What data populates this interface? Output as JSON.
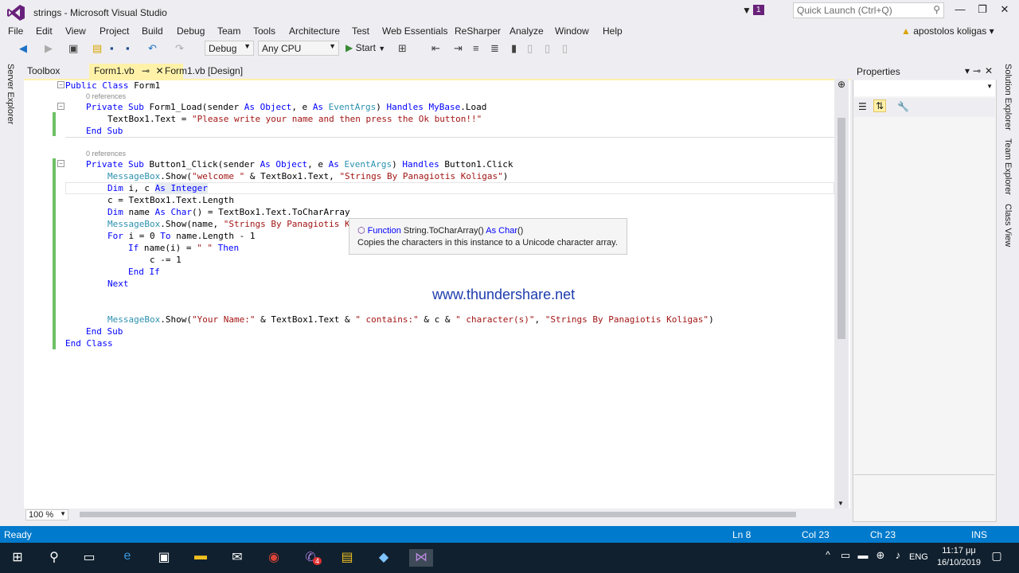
{
  "window": {
    "title": "strings - Microsoft Visual Studio",
    "notifications_count": "1",
    "quick_launch_placeholder": "Quick Launch (Ctrl+Q)",
    "user": "apostolos koligas"
  },
  "menu": [
    "File",
    "Edit",
    "View",
    "Project",
    "Build",
    "Debug",
    "Team",
    "Tools",
    "Architecture",
    "Test",
    "Web Essentials",
    "ReSharper",
    "Analyze",
    "Window",
    "Help"
  ],
  "toolbar": {
    "configuration": "Debug",
    "platform": "Any CPU",
    "start_label": "Start"
  },
  "left_rail": [
    "Server Explorer",
    "Toolbox"
  ],
  "tabs": [
    "Form1.vb",
    "Form1.vb [Design]"
  ],
  "code": {
    "l1": [
      "Public Class",
      " Form1"
    ],
    "refs": "0 references",
    "l2a": "Private Sub",
    "l2b": " Form1_Load(sender ",
    "l2c": "As Object",
    "l2d": ", e ",
    "l2e": "As",
    "l2f": " EventArgs",
    "l2g": ") ",
    "l2h": "Handles",
    "l2i": " MyBase",
    "l2j": ".Load",
    "l3a": "TextBox1.Text = ",
    "l3b": "\"Please write your name and then press the Ok button!!\"",
    "l4": "End Sub",
    "l5a": "Private Sub",
    "l5b": " Button1_Click(sender ",
    "l5c": "As Object",
    "l5d": ", e ",
    "l5e": "As",
    "l5f": " EventArgs",
    "l5g": ") ",
    "l5h": "Handles",
    "l5i": " Button1.Click",
    "l6a": "MessageBox",
    "l6b": ".Show(",
    "l6c": "\"welcome \"",
    "l6d": " & TextBox1.Text, ",
    "l6e": "\"Strings By Panagiotis Koligas\"",
    "l6f": ")",
    "l7a": "Dim",
    "l7b": " i, c ",
    "l7c": "As Integer",
    "l8": "c = TextBox1.Text.Length",
    "l9a": "Dim",
    "l9b": " name ",
    "l9c": "As Char",
    "l9d": "() = TextBox1.Text.ToCharArray",
    "l10a": "MessageBox",
    "l10b": ".Show(name, ",
    "l10c": "\"Strings By Panagiotis K",
    "l11a": "For",
    "l11b": " i = 0 ",
    "l11c": "To",
    "l11d": " name.Length - 1",
    "l12a": "If",
    "l12b": " name(i) = ",
    "l12c": "\" \"",
    "l12d": " Then",
    "l13": "c -= 1",
    "l14": "End If",
    "l15": "Next",
    "l16a": "MessageBox",
    "l16b": ".Show(",
    "l16c": "\"Your Name:\"",
    "l16d": " & TextBox1.Text & ",
    "l16e": "\" contains:\"",
    "l16f": " & c & ",
    "l16g": "\" character(s)\"",
    "l16h": ", ",
    "l16i": "\"Strings By Panagiotis Koligas\"",
    "l16j": ")",
    "l17": "End Sub",
    "l18": "End Class"
  },
  "tooltip": {
    "signature_kw": "Function",
    "signature_name": " String.ToCharArray() ",
    "signature_ret": "As Char",
    "signature_end": "()",
    "description": "Copies the characters in this instance to a Unicode character array."
  },
  "watermark": "www.thundershare.net",
  "zoom": "100 %",
  "properties": {
    "title": "Properties"
  },
  "right_rail": [
    "Solution Explorer",
    "Team Explorer",
    "Class View"
  ],
  "status": {
    "state": "Ready",
    "line": "Ln 8",
    "col": "Col 23",
    "ch": "Ch 23",
    "mode": "INS"
  },
  "taskbar": {
    "lang": "ENG",
    "time": "11:17 μμ",
    "date": "16/10/2019",
    "viber_badge": "4"
  },
  "colors": {
    "accent": "#007acc",
    "vs_purple": "#68217a",
    "taskbar": "#10202e"
  }
}
